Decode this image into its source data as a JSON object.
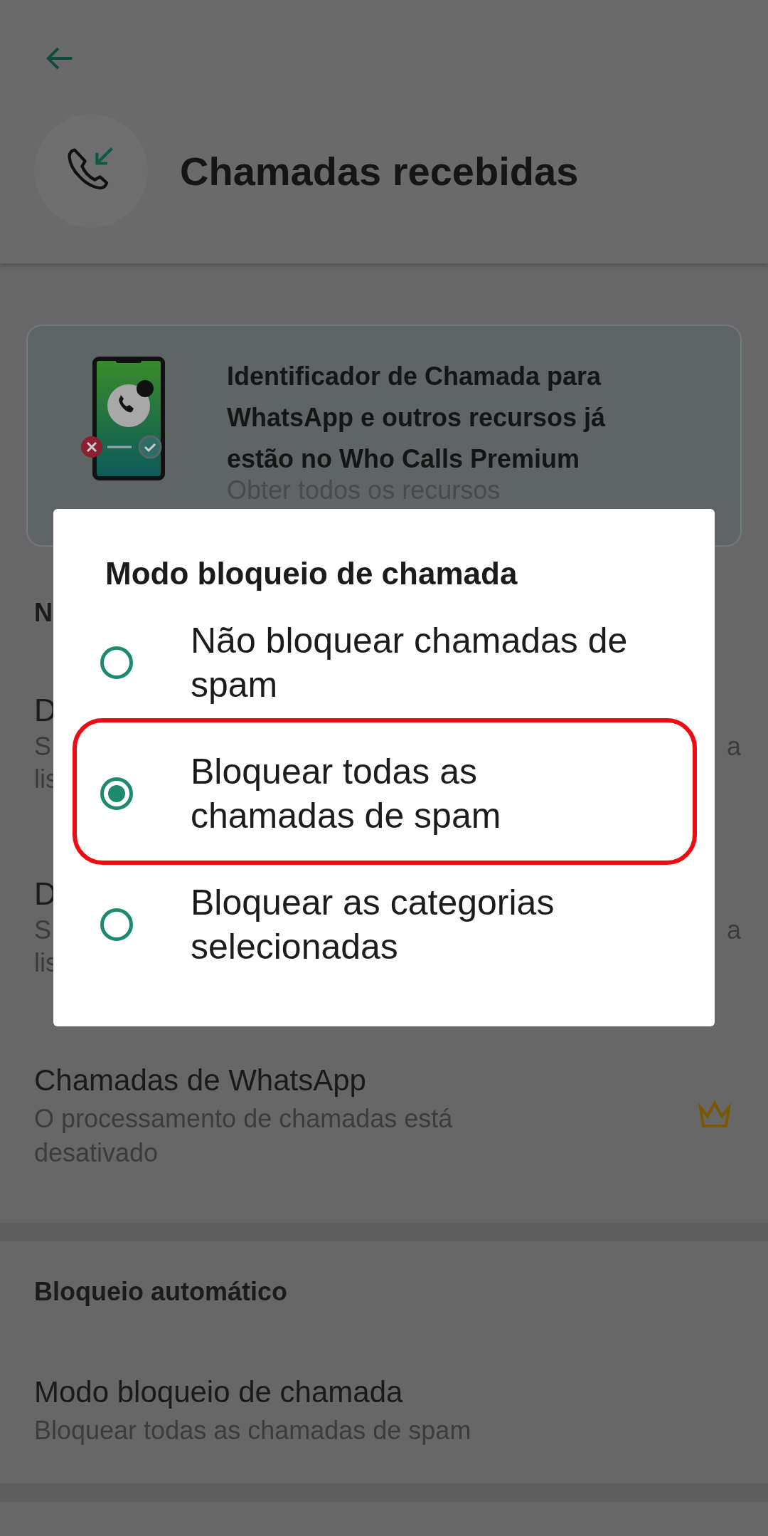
{
  "header": {
    "title": "Chamadas recebidas"
  },
  "promo": {
    "title": "Identificador de Chamada para WhatsApp e outros recursos já estão no Who Calls Premium",
    "link": "Obter todos os recursos"
  },
  "section_1": {
    "heading_fragment": "N",
    "items": [
      {
        "title_fragment": "D",
        "subtitle_fragments": [
          "S",
          "lis"
        ],
        "trailing_fragment": "a"
      },
      {
        "title_fragment": "D",
        "subtitle_fragments": [
          "S",
          "lis"
        ],
        "trailing_fragment": "a"
      }
    ],
    "whatsapp_item": {
      "title": "Chamadas de WhatsApp",
      "subtitle": "O processamento de chamadas está desativado",
      "premium": true
    }
  },
  "auto_block": {
    "heading": "Bloqueio automático",
    "items": [
      {
        "title": "Modo bloqueio de chamada",
        "subtitle": "Bloquear todas as chamadas de spam"
      }
    ]
  },
  "dialog": {
    "title": "Modo bloqueio de chamada",
    "options": [
      {
        "label": "Não bloquear chamadas de spam",
        "selected": false,
        "highlighted": false
      },
      {
        "label": "Bloquear todas as chamadas de spam",
        "selected": true,
        "highlighted": true
      },
      {
        "label": "Bloquear as categorias selecionadas",
        "selected": false,
        "highlighted": false
      }
    ]
  }
}
